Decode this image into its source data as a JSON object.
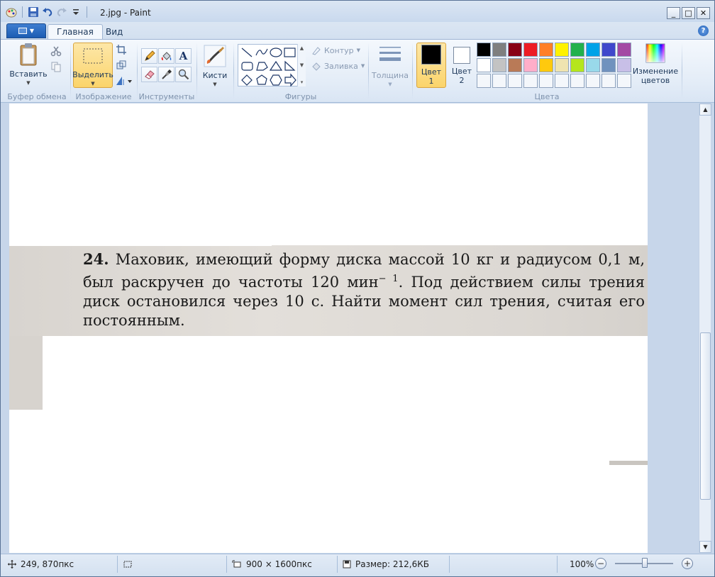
{
  "window": {
    "title": "2.jpg - Paint",
    "controls": {
      "minimize": "_",
      "maximize": "□",
      "close": "✕"
    }
  },
  "tabs": [
    {
      "label": "Главная",
      "active": true
    },
    {
      "label": "Вид",
      "active": false
    }
  ],
  "help_label": "?",
  "ribbon": {
    "clipboard": {
      "paste_label": "Вставить",
      "group_label": "Буфер обмена"
    },
    "image": {
      "select_label": "Выделить",
      "group_label": "Изображение"
    },
    "tools": {
      "group_label": "Инструменты",
      "text_tool": "A"
    },
    "brushes": {
      "label": "Кисти"
    },
    "shapes": {
      "group_label": "Фигуры",
      "outline_label": "Контур",
      "fill_label": "Заливка"
    },
    "size": {
      "label": "Толщина"
    },
    "colors": {
      "group_label": "Цвета",
      "color1_label": "Цвет",
      "color1_num": "1",
      "color2_label": "Цвет",
      "color2_num": "2",
      "color1_value": "#000000",
      "color2_value": "#ffffff",
      "edit_colors_label_line1": "Изменение",
      "edit_colors_label_line2": "цветов",
      "palette": [
        "#000000",
        "#7f7f7f",
        "#880015",
        "#ed1c24",
        "#ff7f27",
        "#fff200",
        "#22b14c",
        "#00a2e8",
        "#3f48cc",
        "#a349a4",
        "#ffffff",
        "#c3c3c3",
        "#b97a57",
        "#ffaec9",
        "#ffc90e",
        "#efe4b0",
        "#b5e61d",
        "#99d9ea",
        "#7092be",
        "#c8bfe7",
        "#f4f7fb",
        "#f4f7fb",
        "#f4f7fb",
        "#f4f7fb",
        "#f4f7fb",
        "#f4f7fb",
        "#f4f7fb",
        "#f4f7fb",
        "#f4f7fb",
        "#f4f7fb"
      ]
    }
  },
  "document": {
    "problem_number": "24.",
    "problem_text_1": " Маховик, имеющий форму диска массой 10 кг и радиусом 0,1 м, был раскручен до частоты 120 мин",
    "superscript": "− 1",
    "problem_text_2": ". Под действием силы трения диск остановился через 10 с. Найти момент сил трения, считая его постоянным."
  },
  "status": {
    "cursor_pos": "249, 870пкс",
    "image_size": "900 × 1600пкс",
    "file_size": "Размер: 212,6КБ",
    "zoom": "100%"
  }
}
